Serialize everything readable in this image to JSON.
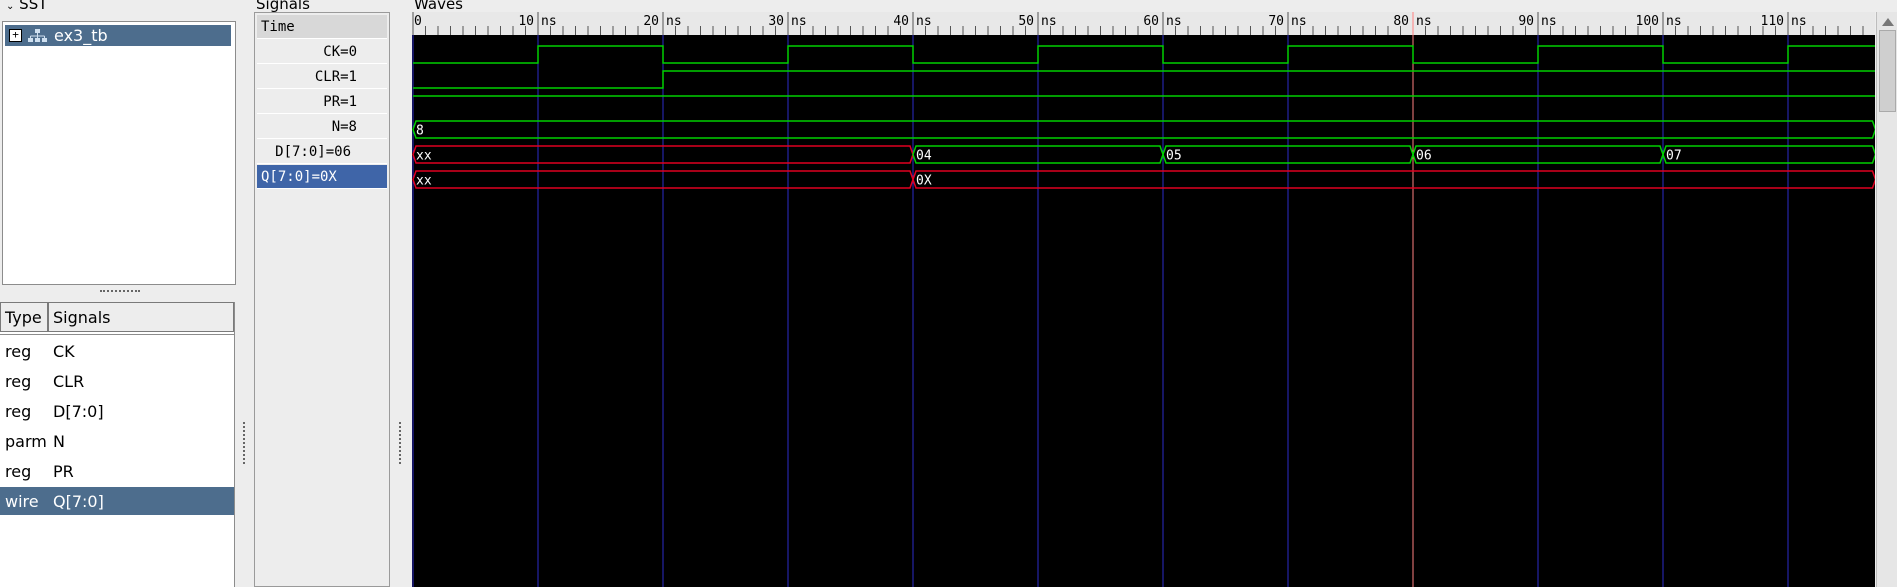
{
  "sst": {
    "title": "SST",
    "tree_item": "ex3_tb",
    "expander": "+",
    "columns": [
      "Type",
      "Signals"
    ],
    "rows": [
      {
        "type": "reg",
        "name": "CK"
      },
      {
        "type": "reg",
        "name": "CLR"
      },
      {
        "type": "reg",
        "name": "D[7:0]"
      },
      {
        "type": "parm",
        "name": "N"
      },
      {
        "type": "reg",
        "name": "PR"
      },
      {
        "type": "wire",
        "name": "Q[7:0]"
      }
    ],
    "selected_row": 5
  },
  "signals": {
    "title": "Signals",
    "header": "Time",
    "rows": [
      "CK=0",
      "CLR=1",
      "PR=1",
      "N=8",
      "D[7:0]=06",
      "Q[7:0]=0X"
    ],
    "selected_row": 5
  },
  "waves": {
    "title": "Waves",
    "ruler_labels": [
      "0",
      "10 ns",
      "20 ns",
      "30 ns",
      "40 ns",
      "50 ns",
      "60 ns",
      "70 ns",
      "80 ns",
      "90 ns",
      "100 ns",
      "110 ns"
    ],
    "time_range_ns": [
      0,
      117
    ],
    "cursor_ns": 80,
    "traces": {
      "CK": {
        "kind": "bit",
        "initial": 0,
        "edges_ns": [
          10,
          20,
          30,
          40,
          50,
          60,
          70,
          80,
          90,
          100,
          110
        ]
      },
      "CLR": {
        "kind": "bit",
        "initial": 0,
        "edges_ns": [
          20
        ]
      },
      "PR": {
        "kind": "bit",
        "initial": 1,
        "edges_ns": []
      },
      "N": {
        "kind": "bus",
        "segments": [
          {
            "from": 0,
            "to": 117,
            "label": "8",
            "color": "#00d000"
          }
        ]
      },
      "D": {
        "kind": "bus",
        "segments": [
          {
            "from": 0,
            "to": 40,
            "label": "xx",
            "color": "#e00020"
          },
          {
            "from": 40,
            "to": 60,
            "label": "04",
            "color": "#00d000"
          },
          {
            "from": 60,
            "to": 80,
            "label": "05",
            "color": "#00d000"
          },
          {
            "from": 80,
            "to": 100,
            "label": "06",
            "color": "#00d000"
          },
          {
            "from": 100,
            "to": 117,
            "label": "07",
            "color": "#00d000"
          }
        ]
      },
      "Q": {
        "kind": "bus",
        "segments": [
          {
            "from": 0,
            "to": 40,
            "label": "xx",
            "color": "#e00020"
          },
          {
            "from": 40,
            "to": 117,
            "label": "0X",
            "color": "#e00020"
          }
        ]
      }
    },
    "colors": {
      "trace": "#00d000",
      "unknown": "#e00020",
      "grid": "#2c2cc8",
      "cursor": "#ff8080",
      "ruler_bg": "#e8e8e8"
    }
  }
}
